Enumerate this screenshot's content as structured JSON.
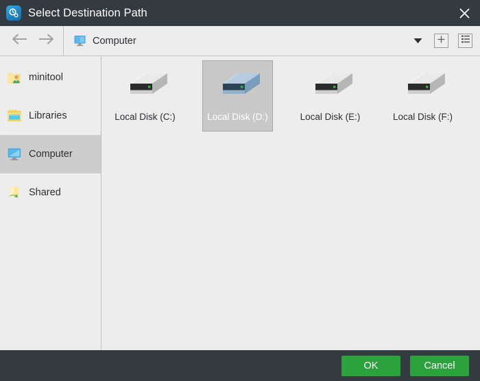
{
  "window": {
    "title": "Select Destination Path",
    "app_icon": "minitool-app-icon",
    "close_icon": "close-icon",
    "titlebar_bg": "#343b40",
    "accent_green": "#2ba23c"
  },
  "toolbar": {
    "back_icon": "arrow-left-icon",
    "forward_icon": "arrow-right-icon",
    "path_icon": "computer-icon",
    "path_label": "Computer",
    "dropdown_icon": "chevron-down-icon",
    "new_folder_icon": "plus-icon",
    "view_list_icon": "list-view-icon"
  },
  "sidebar": {
    "items": [
      {
        "label": "minitool",
        "icon": "user-folder-icon",
        "selected": false
      },
      {
        "label": "Libraries",
        "icon": "libraries-folder-icon",
        "selected": false
      },
      {
        "label": "Computer",
        "icon": "computer-icon",
        "selected": true
      },
      {
        "label": "Shared",
        "icon": "shared-folder-icon",
        "selected": false
      }
    ]
  },
  "files": {
    "items": [
      {
        "label": "Local Disk (C:)",
        "icon": "hard-disk-icon",
        "selected": false
      },
      {
        "label": "Local Disk (D:)",
        "icon": "hard-disk-icon",
        "selected": true
      },
      {
        "label": "Local Disk (E:)",
        "icon": "hard-disk-icon",
        "selected": false
      },
      {
        "label": "Local Disk (F:)",
        "icon": "hard-disk-icon",
        "selected": false
      }
    ]
  },
  "footer": {
    "ok_label": "OK",
    "cancel_label": "Cancel"
  }
}
